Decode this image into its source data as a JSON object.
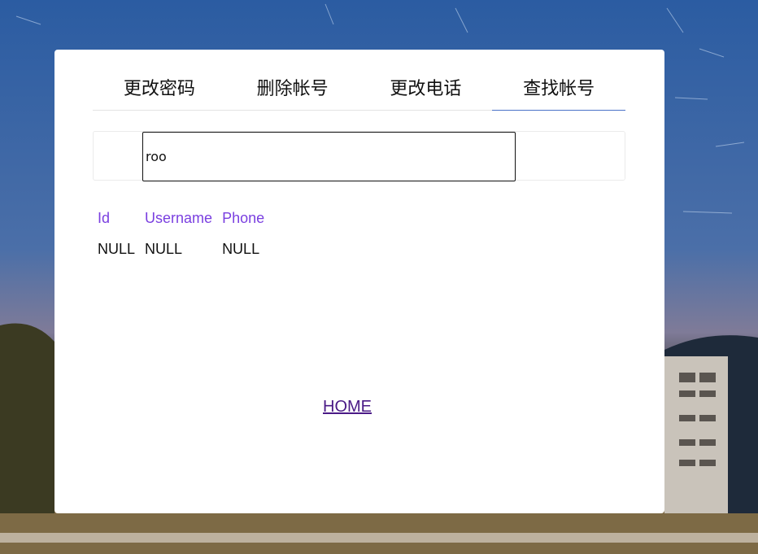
{
  "tabs": [
    {
      "label": "更改密码"
    },
    {
      "label": "删除帐号"
    },
    {
      "label": "更改电话"
    },
    {
      "label": "查找帐号",
      "active": true
    }
  ],
  "search": {
    "value": "roo"
  },
  "table": {
    "headers": [
      "Id",
      "Username",
      "Phone"
    ],
    "rows": [
      [
        "NULL",
        "NULL",
        "NULL"
      ]
    ]
  },
  "home_link": "HOME",
  "colors": {
    "accent": "#4a72c8",
    "header_text": "#7a3fe0",
    "link": "#4a1a86"
  }
}
